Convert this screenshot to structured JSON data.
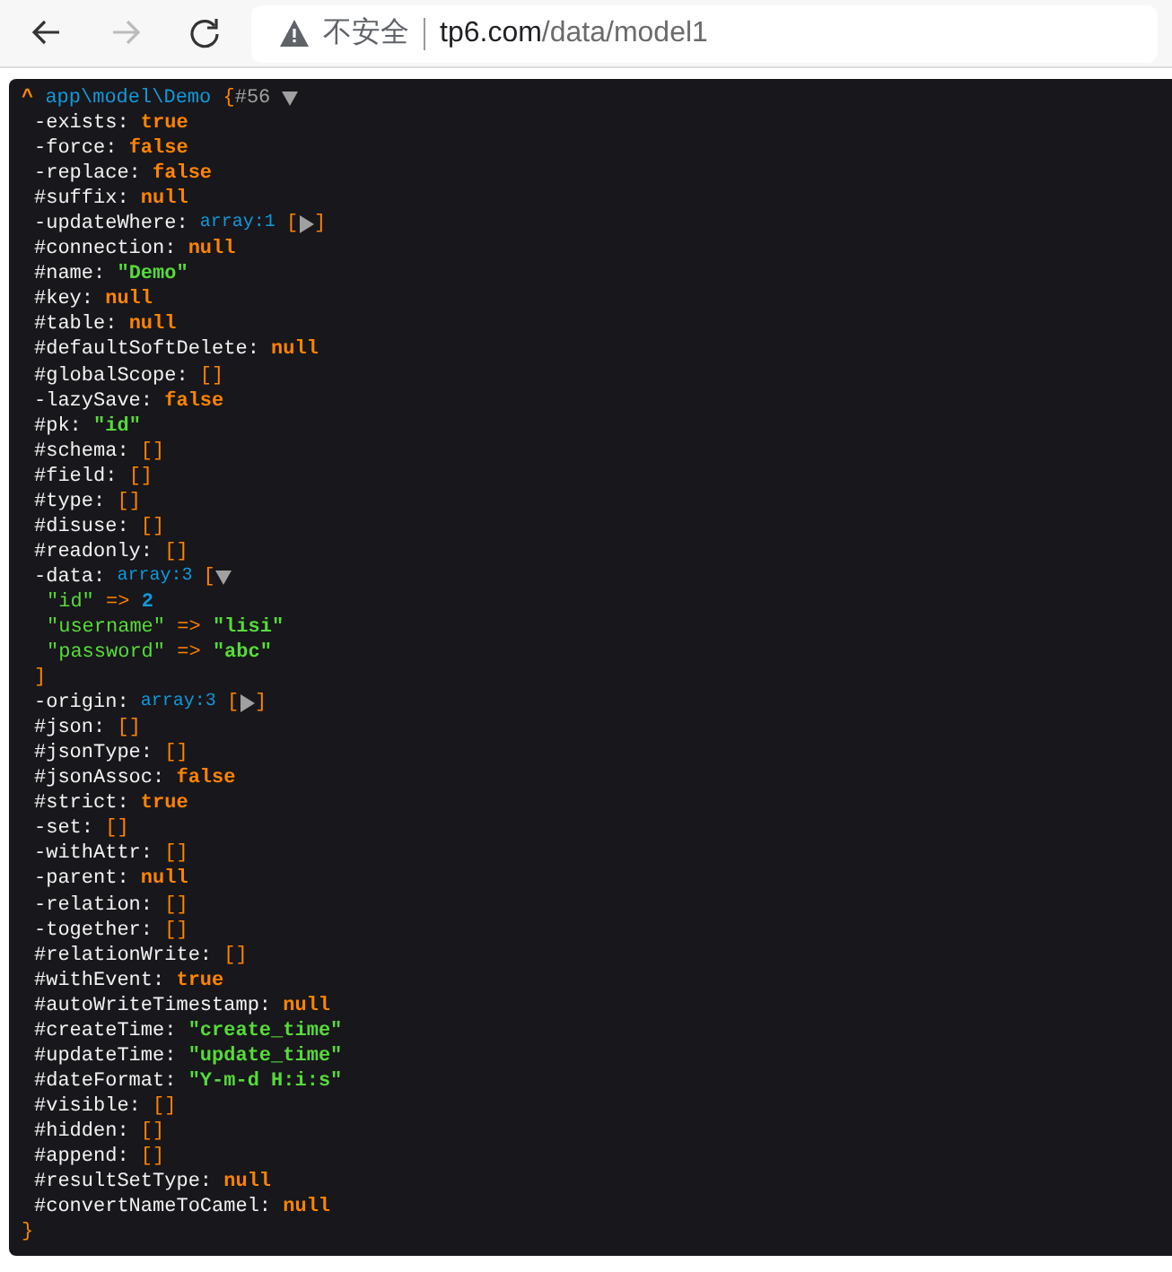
{
  "browser": {
    "back": {
      "disabled": false
    },
    "forward": {
      "disabled": true
    },
    "address": {
      "security_label": "不安全",
      "host": "tp6.com",
      "path": "/data/model1"
    }
  },
  "dump": {
    "caret": "^",
    "class": "app\\model\\Demo",
    "open": "{",
    "ref": "#56",
    "expanded": true,
    "close": "}",
    "properties": [
      {
        "name": "-exists: ",
        "kind": "const",
        "value": "true"
      },
      {
        "name": "-force: ",
        "kind": "const",
        "value": "false"
      },
      {
        "name": "-replace: ",
        "kind": "const",
        "value": "false"
      },
      {
        "name": "#suffix: ",
        "kind": "const",
        "value": "null"
      },
      {
        "name": "-updateWhere: ",
        "kind": "array",
        "count": "array:1",
        "open": "[",
        "close": "]",
        "expanded": false
      },
      {
        "name": "#connection: ",
        "kind": "const",
        "value": "null"
      },
      {
        "name": "#name: ",
        "kind": "string",
        "value": "\"Demo\""
      },
      {
        "name": "#key: ",
        "kind": "const",
        "value": "null"
      },
      {
        "name": "#table: ",
        "kind": "const",
        "value": "null"
      },
      {
        "name": "#defaultSoftDelete: ",
        "kind": "const",
        "value": "null"
      },
      {
        "name": "#globalScope: ",
        "kind": "empty",
        "value": "[]"
      },
      {
        "name": "-lazySave: ",
        "kind": "const",
        "value": "false"
      },
      {
        "name": "#pk: ",
        "kind": "string",
        "value": "\"id\""
      },
      {
        "name": "#schema: ",
        "kind": "empty",
        "value": "[]"
      },
      {
        "name": "#field: ",
        "kind": "empty",
        "value": "[]"
      },
      {
        "name": "#type: ",
        "kind": "empty",
        "value": "[]"
      },
      {
        "name": "#disuse: ",
        "kind": "empty",
        "value": "[]"
      },
      {
        "name": "#readonly: ",
        "kind": "empty",
        "value": "[]"
      },
      {
        "name": "-data: ",
        "kind": "array",
        "count": "array:3",
        "open": "[",
        "close": "]",
        "expanded": true,
        "children": [
          {
            "key": "\"id\"",
            "op": "=>",
            "kind": "number",
            "value": "2"
          },
          {
            "key": "\"username\"",
            "op": "=>",
            "kind": "string",
            "value": "\"lisi\""
          },
          {
            "key": "\"password\"",
            "op": "=>",
            "kind": "string",
            "value": "\"abc\""
          }
        ]
      },
      {
        "name": "-origin: ",
        "kind": "array",
        "count": "array:3",
        "open": "[",
        "close": "]",
        "expanded": false
      },
      {
        "name": "#json: ",
        "kind": "empty",
        "value": "[]"
      },
      {
        "name": "#jsonType: ",
        "kind": "empty",
        "value": "[]"
      },
      {
        "name": "#jsonAssoc: ",
        "kind": "const",
        "value": "false"
      },
      {
        "name": "#strict: ",
        "kind": "const",
        "value": "true"
      },
      {
        "name": "-set: ",
        "kind": "empty",
        "value": "[]"
      },
      {
        "name": "-withAttr: ",
        "kind": "empty",
        "value": "[]"
      },
      {
        "name": "-parent: ",
        "kind": "const",
        "value": "null"
      },
      {
        "name": "-relation: ",
        "kind": "empty",
        "value": "[]"
      },
      {
        "name": "-together: ",
        "kind": "empty",
        "value": "[]"
      },
      {
        "name": "#relationWrite: ",
        "kind": "empty",
        "value": "[]"
      },
      {
        "name": "#withEvent: ",
        "kind": "const",
        "value": "true"
      },
      {
        "name": "#autoWriteTimestamp: ",
        "kind": "const",
        "value": "null"
      },
      {
        "name": "#createTime: ",
        "kind": "string",
        "value": "\"create_time\""
      },
      {
        "name": "#updateTime: ",
        "kind": "string",
        "value": "\"update_time\""
      },
      {
        "name": "#dateFormat: ",
        "kind": "string",
        "value": "\"Y-m-d H:i:s\""
      },
      {
        "name": "#visible: ",
        "kind": "empty",
        "value": "[]"
      },
      {
        "name": "#hidden: ",
        "kind": "empty",
        "value": "[]"
      },
      {
        "name": "#append: ",
        "kind": "empty",
        "value": "[]"
      },
      {
        "name": "#resultSetType: ",
        "kind": "const",
        "value": "null"
      },
      {
        "name": "#convertNameToCamel: ",
        "kind": "const",
        "value": "null"
      }
    ]
  }
}
